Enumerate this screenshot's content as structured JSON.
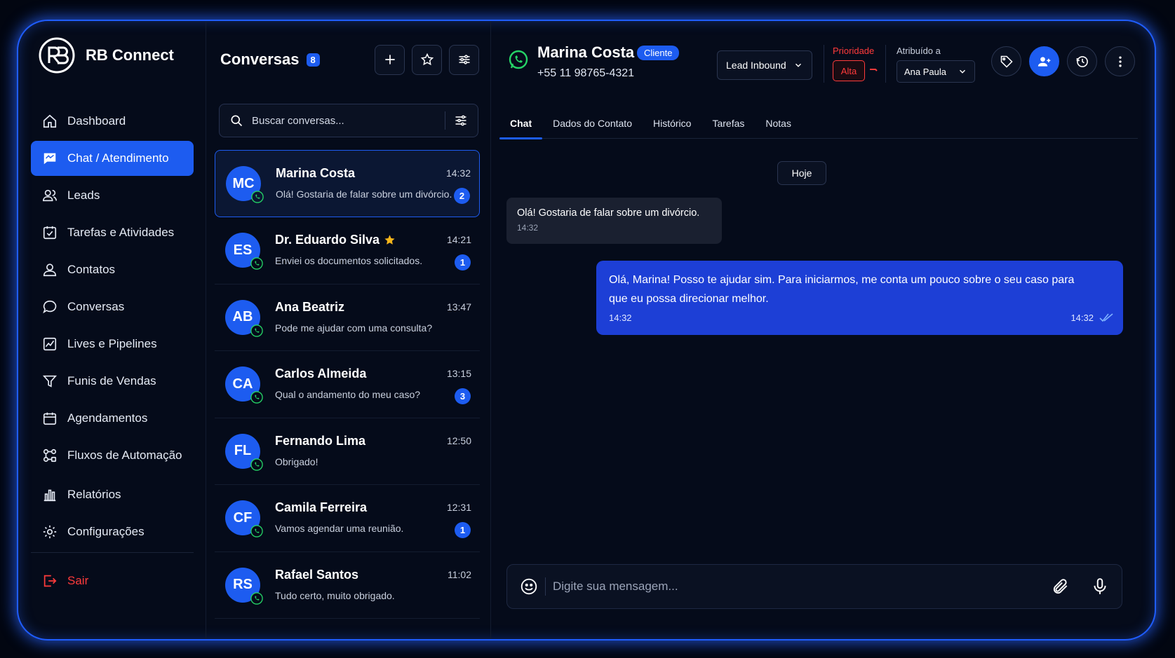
{
  "brand": {
    "name": "RB Connect"
  },
  "sidebar": {
    "items": [
      {
        "label": "Dashboard",
        "icon": "home-icon"
      },
      {
        "label": "Chat / Atendimento",
        "icon": "chat-icon",
        "active": true
      },
      {
        "label": "Leads",
        "icon": "users-icon"
      },
      {
        "label": "Tarefas e Atividades",
        "icon": "checklist-icon"
      },
      {
        "label": "Contatos",
        "icon": "user-icon"
      },
      {
        "label": "Conversas",
        "icon": "message-bubble-icon"
      },
      {
        "label": "Lives e Pipelines",
        "icon": "pipeline-chart-icon"
      },
      {
        "label": "Funis de Vendas",
        "icon": "funnel-icon"
      },
      {
        "label": "Agendamentos",
        "icon": "calendar-icon"
      },
      {
        "label": "Fluxos de Automação",
        "icon": "automation-icon"
      },
      {
        "label": "Relatórios",
        "icon": "bar-chart-icon"
      },
      {
        "label": "Configurações",
        "icon": "gear-icon"
      }
    ],
    "logout": "Sair"
  },
  "conversations": {
    "title": "Conversas",
    "count": "8",
    "search_placeholder": "Buscar conversas...",
    "items": [
      {
        "initials": "MC",
        "name": "Marina Costa",
        "message": "Olá! Gostaria de falar sobre um divórcio.",
        "time": "14:32",
        "unread": "2",
        "active": true
      },
      {
        "initials": "ES",
        "name": "Dr. Eduardo Silva",
        "message": "Enviei os documentos solicitados.",
        "time": "14:21",
        "unread": "1",
        "starred": true
      },
      {
        "initials": "AB",
        "name": "Ana Beatriz",
        "message": "Pode me ajudar com uma consulta?",
        "time": "13:47",
        "unread": ""
      },
      {
        "initials": "CA",
        "name": "Carlos Almeida",
        "message": "Qual o andamento do meu caso?",
        "time": "13:15",
        "unread": "3"
      },
      {
        "initials": "FL",
        "name": "Fernando Lima",
        "message": "Obrigado!",
        "time": "12:50",
        "unread": ""
      },
      {
        "initials": "CF",
        "name": "Camila Ferreira",
        "message": "Vamos agendar uma reunião.",
        "time": "12:31",
        "unread": "1"
      },
      {
        "initials": "RS",
        "name": "Rafael Santos",
        "message": "Tudo certo, muito obrigado.",
        "time": "11:02",
        "unread": ""
      }
    ]
  },
  "chat": {
    "contact_name": "Marina Costa",
    "contact_badge": "Cliente",
    "contact_phone": "+55 11 98765-4321",
    "lead_source": "Lead Inbound",
    "priority_label": "Prioridade",
    "priority_value": "Alta",
    "assigned_label": "Atribuído a",
    "assigned_value": "Ana Paula",
    "tabs": [
      "Chat",
      "Dados do Contato",
      "Histórico",
      "Tarefas",
      "Notas"
    ],
    "day_label": "Hoje",
    "messages": [
      {
        "direction": "in",
        "text": "Olá! Gostaria de falar sobre um divórcio.",
        "time": "14:32"
      },
      {
        "direction": "out",
        "text": "Olá, Marina! Posso te ajudar sim. Para iniciarmos, me conta um pouco sobre o seu caso para que eu possa direcionar melhor.",
        "time": "14:32",
        "time_right": "14:32"
      }
    ],
    "composer_placeholder": "Digite sua mensagem..."
  },
  "colors": {
    "accent": "#1d5cf0",
    "danger": "#ff3b3b",
    "whatsapp": "#25d366",
    "star": "#f5b51b"
  }
}
